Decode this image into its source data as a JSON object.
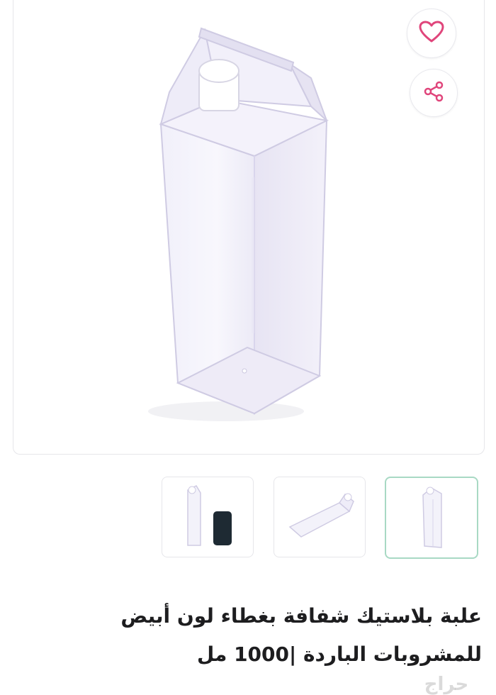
{
  "product": {
    "title": "علبة بلاستيك شفافة بغطاء لون أبيض للمشروبات الباردة |1000 مل",
    "main_image_alt": "علبة بلاستيك شفافة"
  },
  "actions": {
    "favorite_icon": "heart-icon",
    "share_icon": "share-icon",
    "accent_color": "#e0457b"
  },
  "gallery": {
    "thumbnails": [
      {
        "alt": "bottle with phone for size"
      },
      {
        "alt": "bottle lying flat"
      },
      {
        "alt": "bottle upright"
      }
    ],
    "active_index": 2,
    "active_border_color": "#a8d9c4"
  },
  "watermark": {
    "text": "حراج"
  }
}
